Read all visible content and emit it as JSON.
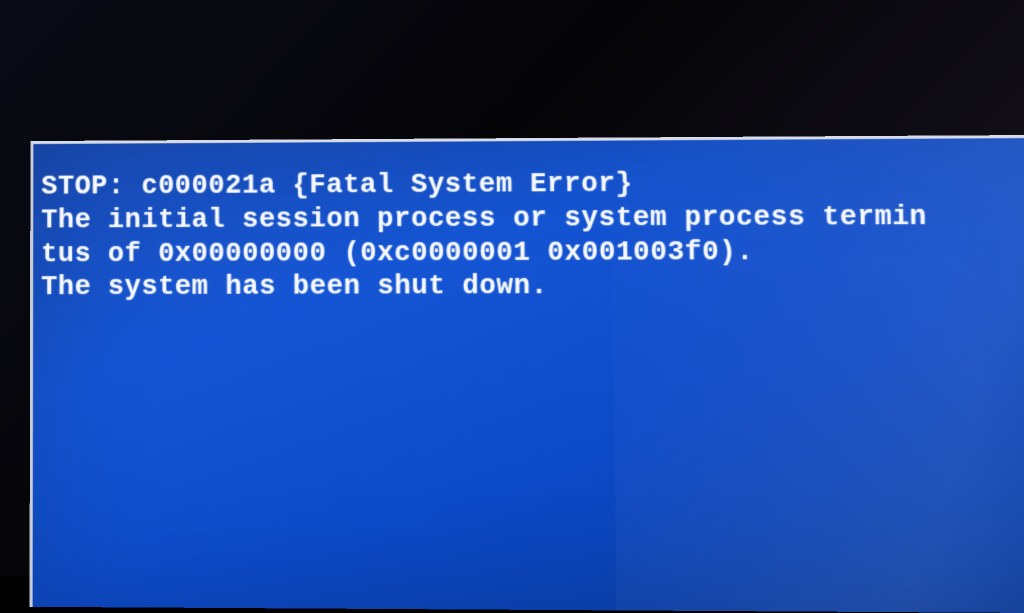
{
  "bsod": {
    "line1": "STOP: c000021a {Fatal System Error}",
    "line2": "The initial session process or system process termin",
    "line3": "tus of 0x00000000 (0xc0000001 0x001003f0).",
    "line4": "The system has been shut down."
  }
}
